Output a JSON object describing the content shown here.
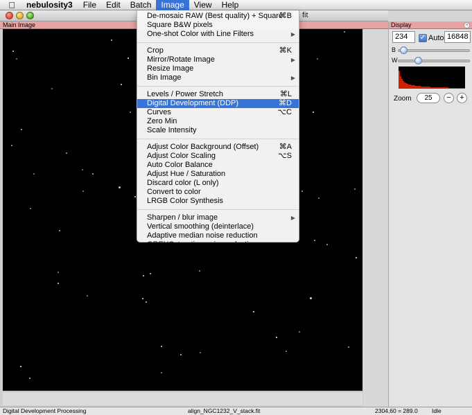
{
  "menubar": {
    "apple_icon": "apple-icon",
    "app_name": "nebulosity3",
    "items": [
      "File",
      "Edit",
      "Batch",
      "Image",
      "View",
      "Help"
    ],
    "active_item": "Image"
  },
  "window": {
    "title_fragment": "fit"
  },
  "main_panel": {
    "title": "Main Image"
  },
  "image_menu": {
    "groups": [
      [
        {
          "label": "De-mosaic RAW (Best quality) + Square",
          "shortcut": "⌘B",
          "submenu": false
        },
        {
          "label": "Square B&W pixels",
          "shortcut": "",
          "submenu": false
        },
        {
          "label": "One-shot Color with Line Filters",
          "shortcut": "",
          "submenu": true
        }
      ],
      [
        {
          "label": "Crop",
          "shortcut": "⌘K",
          "submenu": false
        },
        {
          "label": "Mirror/Rotate Image",
          "shortcut": "",
          "submenu": true
        },
        {
          "label": "Resize Image",
          "shortcut": "",
          "submenu": false
        },
        {
          "label": "Bin Image",
          "shortcut": "",
          "submenu": true
        }
      ],
      [
        {
          "label": "Levels / Power Stretch",
          "shortcut": "⌘L",
          "submenu": false
        },
        {
          "label": "Digital Development (DDP)",
          "shortcut": "⌘D",
          "submenu": false,
          "selected": true
        },
        {
          "label": "Curves",
          "shortcut": "⌥C",
          "submenu": false
        },
        {
          "label": "Zero Min",
          "shortcut": "",
          "submenu": false
        },
        {
          "label": "Scale Intensity",
          "shortcut": "",
          "submenu": false
        }
      ],
      [
        {
          "label": "Adjust Color Background (Offset)",
          "shortcut": "⌘A",
          "submenu": false
        },
        {
          "label": "Adjust Color Scaling",
          "shortcut": "⌥S",
          "submenu": false
        },
        {
          "label": "Auto Color Balance",
          "shortcut": "",
          "submenu": false
        },
        {
          "label": "Adjust Hue / Saturation",
          "shortcut": "",
          "submenu": false
        },
        {
          "label": "Discard color (L only)",
          "shortcut": "",
          "submenu": false
        },
        {
          "label": "Convert to color",
          "shortcut": "",
          "submenu": false
        },
        {
          "label": "LRGB Color Synthesis",
          "shortcut": "",
          "submenu": false
        }
      ],
      [
        {
          "label": "Sharpen / blur image",
          "shortcut": "",
          "submenu": true
        },
        {
          "label": "Vertical smoothing (deinterlace)",
          "shortcut": "",
          "submenu": false
        },
        {
          "label": "Adaptive median noise reduction",
          "shortcut": "",
          "submenu": false
        },
        {
          "label": "GREYCstoration noise reduction",
          "shortcut": "",
          "submenu": false
        }
      ]
    ]
  },
  "display_panel": {
    "title": "Display",
    "black_value": "234",
    "auto_label": "Auto",
    "auto_checked": true,
    "white_value": "16848",
    "b_label": "B",
    "w_label": "W",
    "b_slider_level": 0.02,
    "w_slider_level": 0.25,
    "zoom_label": "Zoom",
    "zoom_value": "25",
    "zoom_minus": "−",
    "zoom_plus": "+",
    "histogram_color": "#cc2200"
  },
  "statusbar": {
    "message": "Digital Development Processing",
    "filename": "align_NGC1232_V_stack.fit",
    "coords": "2304,60 = 289.0",
    "state": "Idle"
  },
  "colors": {
    "menu_highlight": "#3874d8",
    "panel_header": "#e8a3a3",
    "image_background": "#000000"
  }
}
